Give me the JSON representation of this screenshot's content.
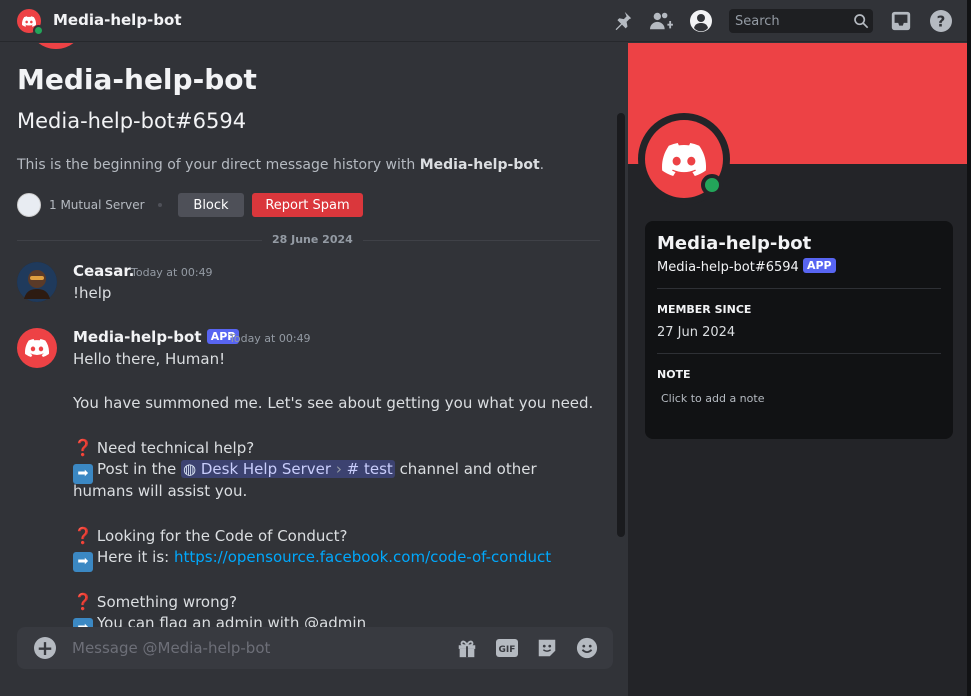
{
  "topbar": {
    "title": "Media-help-bot",
    "search_placeholder": "Search",
    "icons": [
      "pin-icon",
      "add-friend-icon",
      "user-profile-icon",
      "search-icon",
      "inbox-icon",
      "help-icon"
    ]
  },
  "intro": {
    "title": "Media-help-bot",
    "tag": "Media-help-bot#6594",
    "text_prefix": "This is the beginning of your direct message history with ",
    "text_bold": "Media-help-bot",
    "text_suffix": ".",
    "mutual": "1 Mutual Server",
    "block_label": "Block",
    "spam_label": "Report Spam"
  },
  "divider_date": "28 June 2024",
  "messages": [
    {
      "author": "Ceasar.",
      "time": "Today at 00:49",
      "lines": [
        "!help"
      ]
    },
    {
      "author": "Media-help-bot",
      "badge": "APP",
      "time": "Today at 00:49",
      "greeting": "Hello there, Human!",
      "summoned": " You have summoned me. Let's see about getting you what you need.",
      "q1": "Need technical help?",
      "a1_prefix": "Post in the ",
      "a1_server": "Desk Help Server",
      "a1_channel": "test",
      "a1_suffix": " channel and other",
      "a1_line2": "humans will assist you.",
      "q2": "Looking for the Code of Conduct?",
      "a2_prefix": "Here it is: ",
      "a2_link": "https://opensource.facebook.com/code-of-conduct",
      "q3": "Something wrong?",
      "a3": "You can flag an admin with @admin"
    }
  ],
  "composer": {
    "placeholder": "Message @Media-help-bot",
    "gif_label": "GIF"
  },
  "profile": {
    "name": "Media-help-bot",
    "tag": "Media-help-bot#6594",
    "badge": "APP",
    "member_since_label": "MEMBER SINCE",
    "member_since": "27 Jun 2024",
    "note_label": "NOTE",
    "note_placeholder": "Click to add a note"
  },
  "colors": {
    "brand_red": "#ed4245",
    "online": "#23a55a",
    "blurple": "#5865f2",
    "link": "#00a8fc"
  }
}
